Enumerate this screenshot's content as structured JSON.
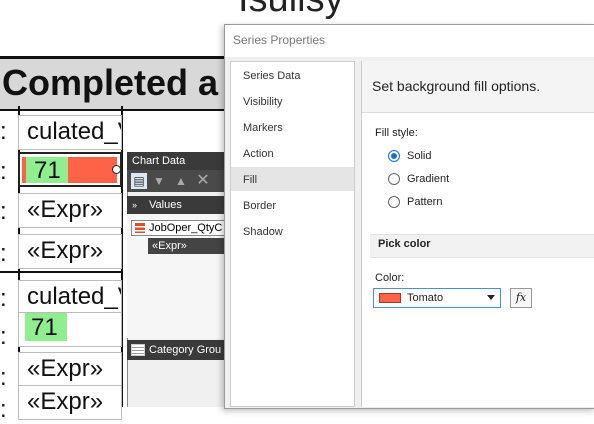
{
  "report": {
    "top_partial_text": "Isuilsy",
    "header_text": "Completed a",
    "rows": [
      {
        "colon": ":",
        "text": "culated_V"
      },
      {
        "colon": ":",
        "text": "71",
        "highlight": "#ff6347",
        "badge": "#90ee90"
      },
      {
        "colon": ":",
        "text": "«Expr»"
      },
      {
        "colon": ":",
        "text": "«Expr»"
      },
      {
        "colon": ":",
        "text": "culated_V"
      },
      {
        "colon": ":",
        "text": "71",
        "badge": "#90ee90"
      },
      {
        "colon": ":",
        "text": "«Expr»"
      },
      {
        "colon": ":",
        "text": "«Expr»"
      }
    ]
  },
  "chart_data_panel": {
    "title": "Chart Data",
    "values_label": "Values",
    "value_item": "JobOper_QtyC",
    "expr_item": "«Expr»",
    "category_label": "Category Grou"
  },
  "dialog": {
    "title": "Series Properties",
    "nav_items": [
      "Series Data",
      "Visibility",
      "Markers",
      "Action",
      "Fill",
      "Border",
      "Shadow"
    ],
    "selected_nav": "Fill",
    "header": "Set background fill options.",
    "fill_style_label": "Fill style:",
    "fill_options": [
      {
        "label": "Solid",
        "checked": true
      },
      {
        "label": "Gradient",
        "checked": false
      },
      {
        "label": "Pattern",
        "checked": false
      }
    ],
    "pick_color_label": "Pick color",
    "color_label": "Color:",
    "color_value": "Tomato",
    "color_hex": "#ff6347",
    "fx_label": "fx"
  }
}
